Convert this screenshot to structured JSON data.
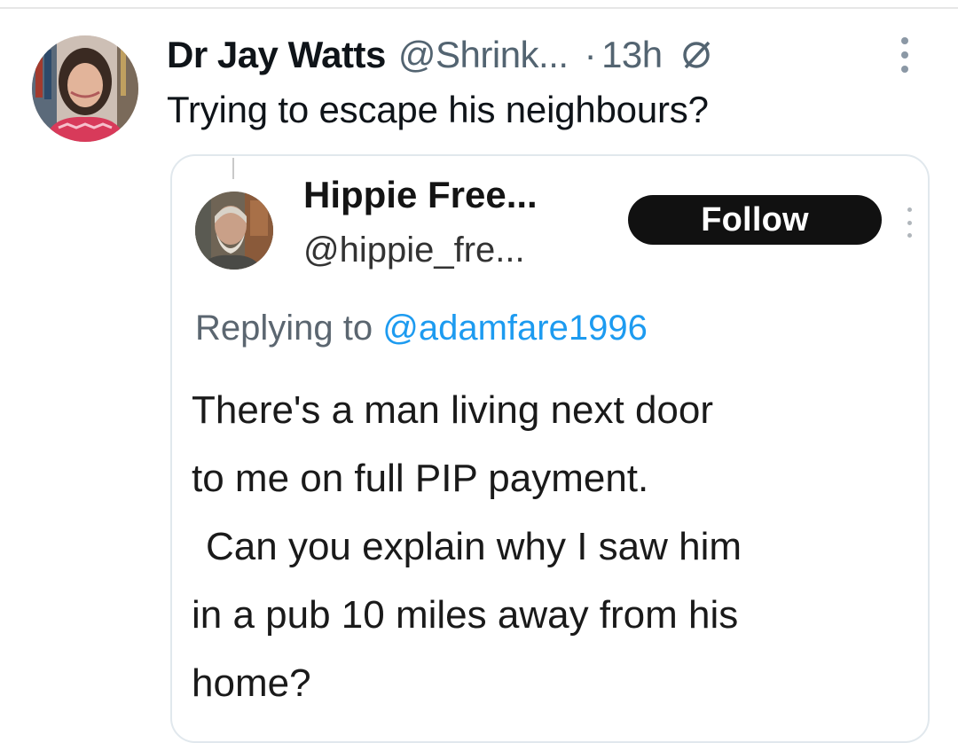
{
  "tweet": {
    "author_name": "Dr Jay Watts",
    "author_handle": "@Shrink...",
    "separator": "·",
    "time": "13h",
    "text": "Trying to escape his neighbours?",
    "icons": [
      "avatar",
      "circle-slash-icon",
      "more-vertical-icon"
    ]
  },
  "quoted": {
    "author_name": "Hippie Free...",
    "author_handle": "@hippie_fre...",
    "follow_label": "Follow",
    "replying_prefix": "Replying to",
    "replying_to": "@adamfare1996",
    "body_lines": [
      "There's a man living next door",
      "to me on full PIP payment.",
      "Can you explain why I saw him",
      "in a pub 10 miles away from his",
      "home?"
    ]
  },
  "colors": {
    "text_primary": "#0f1419",
    "text_secondary": "#536471",
    "link": "#1d9bf0",
    "button_bg": "#111111",
    "border": "#e1e8ed"
  }
}
